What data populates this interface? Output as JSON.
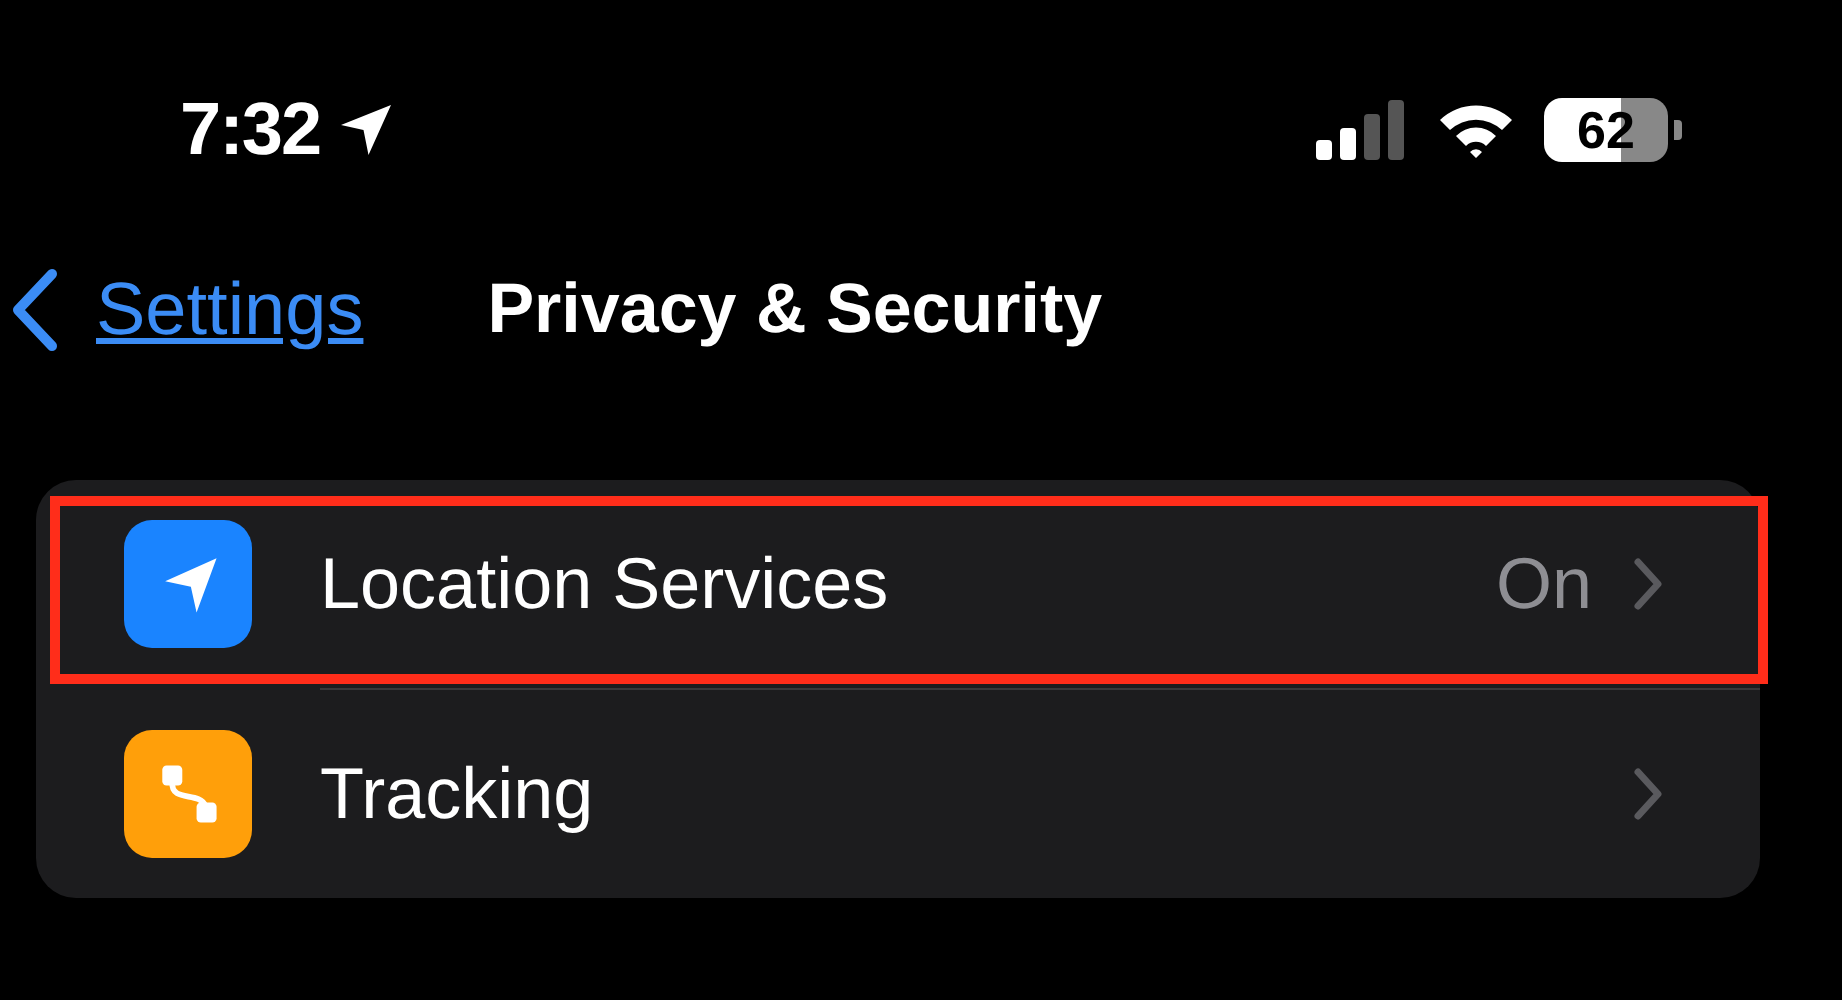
{
  "status_bar": {
    "time": "7:32",
    "battery": "62"
  },
  "nav": {
    "back": "Settings",
    "title": "Privacy & Security"
  },
  "items": [
    {
      "label": "Location Services",
      "value": "On",
      "kind": "location",
      "highlighted": true
    },
    {
      "label": "Tracking",
      "kind": "tracking",
      "highlighted": false
    }
  ]
}
